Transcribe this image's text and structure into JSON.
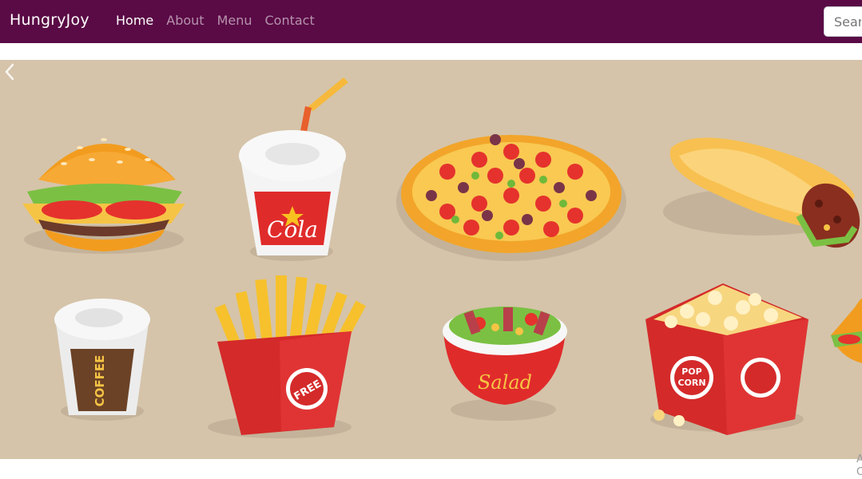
{
  "navbar": {
    "brand": "HungryJoy",
    "links": [
      {
        "label": "Home",
        "active": true
      },
      {
        "label": "About",
        "active": false
      },
      {
        "label": "Menu",
        "active": false
      },
      {
        "label": "Contact",
        "active": false
      }
    ],
    "search_placeholder": "Search",
    "bg_color": "#5a0a45"
  },
  "carousel": {
    "bg_color": "#d5c4aa",
    "items": {
      "cola_label": "Cola",
      "coffee_label": "COFFEE",
      "fries_label": "FREE",
      "salad_label": "Salad",
      "popcorn_label_1": "POP",
      "popcorn_label_2": "CORN"
    },
    "prev_icon": "chevron-left-icon"
  },
  "caption": {
    "line1": "A",
    "line2": "C"
  }
}
